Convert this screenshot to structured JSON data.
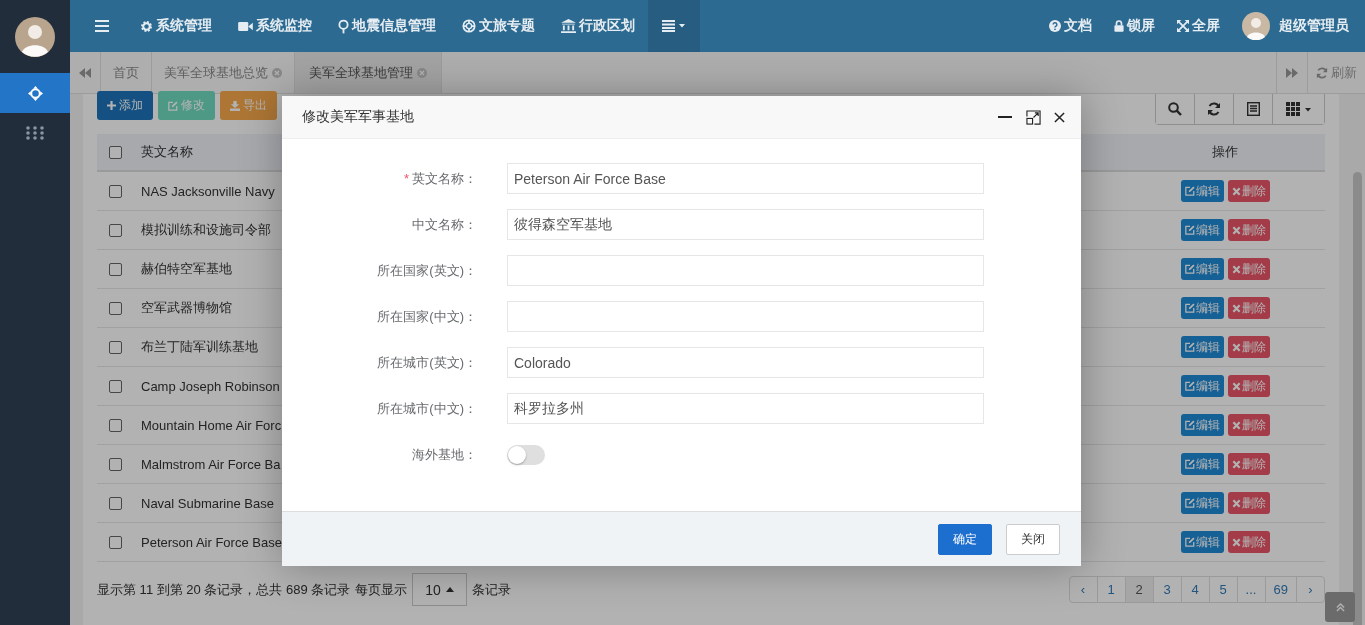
{
  "sidebar": {
    "items": [
      {
        "kind": "crosshair",
        "selected": true
      },
      {
        "kind": "grid",
        "selected": false
      }
    ]
  },
  "top_nav": {
    "items": [
      {
        "kind": "menu"
      },
      {
        "kind": "gear",
        "label": "系统管理"
      },
      {
        "kind": "video",
        "label": "系统监控"
      },
      {
        "kind": "pin",
        "label": "地震信息管理"
      },
      {
        "kind": "lifebuoy",
        "label": "文旅专题"
      },
      {
        "kind": "bank",
        "label": "行政区划"
      },
      {
        "kind": "more"
      }
    ],
    "right": [
      {
        "kind": "question",
        "label": "文档"
      },
      {
        "kind": "lock",
        "label": "锁屏"
      },
      {
        "kind": "expand",
        "label": "全屏"
      },
      {
        "kind": "avatar",
        "label": "超级管理员"
      }
    ]
  },
  "tabs": [
    {
      "label": "首页",
      "closable": false,
      "selected": false
    },
    {
      "label": "美军全球基地总览",
      "closable": true,
      "selected": false
    },
    {
      "label": "美军全球基地管理",
      "closable": true,
      "selected": true
    }
  ],
  "refresh_label": "刷新",
  "toolbar": {
    "buttons": [
      {
        "kind": "add",
        "label": "添加"
      },
      {
        "kind": "edit",
        "label": "修改"
      },
      {
        "kind": "export",
        "label": "导出"
      }
    ],
    "tools": [
      {
        "kind": "search"
      },
      {
        "kind": "refresh"
      },
      {
        "kind": "list"
      },
      {
        "kind": "columns"
      }
    ]
  },
  "table": {
    "select_all_checked": false,
    "columns": [
      "英文名称",
      "操作"
    ],
    "rows": [
      {
        "name": "NAS Jacksonville Navy",
        "checked": false,
        "actions": [
          "编辑",
          "删除"
        ]
      },
      {
        "name": "模拟训练和设施司令部",
        "checked": false,
        "actions": [
          "编辑",
          "删除"
        ]
      },
      {
        "name": "赫伯特空军基地",
        "checked": false,
        "actions": [
          "编辑",
          "删除"
        ]
      },
      {
        "name": "空军武器博物馆",
        "checked": false,
        "actions": [
          "编辑",
          "删除"
        ]
      },
      {
        "name": "布兰丁陆军训练基地",
        "checked": false,
        "actions": [
          "编辑",
          "删除"
        ]
      },
      {
        "name": "Camp Joseph Robinson",
        "checked": false,
        "actions": [
          "编辑",
          "删除"
        ]
      },
      {
        "name": "Mountain Home Air Forc",
        "checked": false,
        "actions": [
          "编辑",
          "删除"
        ]
      },
      {
        "name": "Malmstrom Air Force Ba",
        "checked": false,
        "actions": [
          "编辑",
          "删除"
        ]
      },
      {
        "name": "Naval Submarine Base",
        "checked": false,
        "actions": [
          "编辑",
          "删除"
        ]
      },
      {
        "name": "Peterson Air Force Base",
        "checked": false,
        "actions": [
          "编辑",
          "删除"
        ]
      }
    ]
  },
  "pagination": {
    "info": "显示第 11 到第 20 条记录，总共 689 条记录",
    "per_page_label": "每页显示",
    "page_size": "10",
    "per_page_suffix": "条记录",
    "pages": [
      {
        "label": "‹",
        "selected": false
      },
      {
        "label": "1",
        "selected": false
      },
      {
        "label": "2",
        "selected": true
      },
      {
        "label": "3",
        "selected": false
      },
      {
        "label": "4",
        "selected": false
      },
      {
        "label": "5",
        "selected": false
      },
      {
        "label": "...",
        "selected": false
      },
      {
        "label": "69",
        "selected": false
      },
      {
        "label": "›",
        "selected": false
      }
    ]
  },
  "dialog": {
    "title": "修改美军军事基地",
    "fields": [
      {
        "kind": "text",
        "label": "英文名称：",
        "required_mark": "*",
        "value": "Peterson Air Force Base"
      },
      {
        "kind": "text",
        "label": "中文名称：",
        "value": "彼得森空军基地"
      },
      {
        "kind": "text",
        "label": "所在国家(英文)："
      },
      {
        "kind": "text",
        "label": "所在国家(中文)："
      },
      {
        "kind": "text",
        "label": "所在城市(英文)：",
        "value": "Colorado"
      },
      {
        "kind": "text",
        "label": "所在城市(中文)：",
        "value": "科罗拉多州"
      },
      {
        "kind": "toggle",
        "label": "海外基地：",
        "on": false
      }
    ],
    "buttons": [
      {
        "kind": "primary",
        "label": "确定"
      },
      {
        "kind": "default",
        "label": "关闭"
      }
    ]
  }
}
